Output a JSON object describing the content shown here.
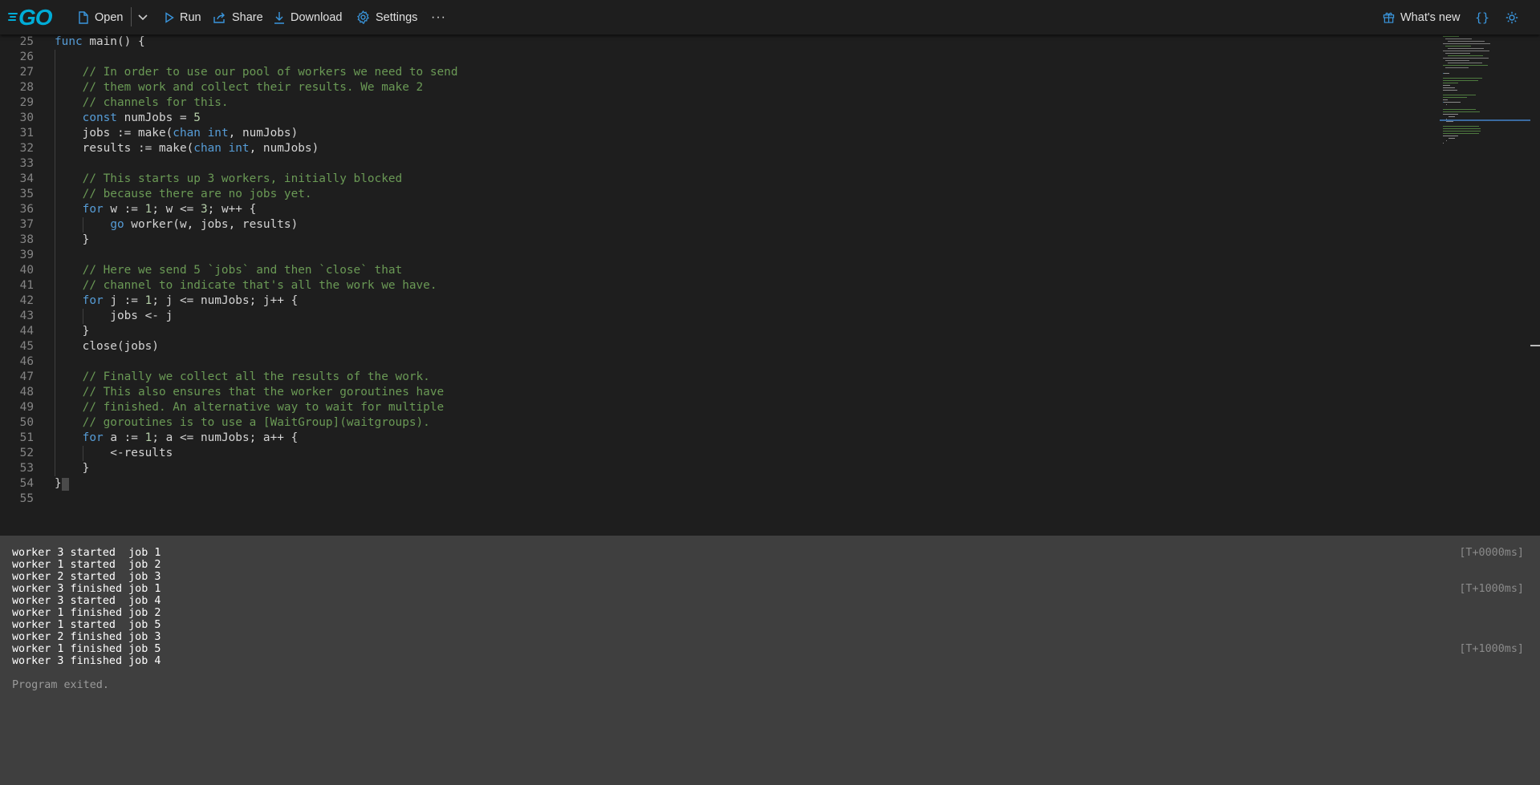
{
  "app": {
    "logo_text": "GO"
  },
  "toolbar": {
    "open_label": "Open",
    "run_label": "Run",
    "share_label": "Share",
    "download_label": "Download",
    "settings_label": "Settings",
    "more_label": "···",
    "whats_new_label": "What's new",
    "format_label": "{}"
  },
  "editor": {
    "lines": [
      {
        "n": "25",
        "tokens": [
          {
            "t": "k",
            "s": "func"
          },
          {
            "t": "p",
            "s": " main() {"
          }
        ]
      },
      {
        "n": "26",
        "tokens": []
      },
      {
        "n": "27",
        "tokens": [
          {
            "t": "p",
            "s": "    "
          },
          {
            "t": "c",
            "s": "// In order to use our pool of workers we need to send"
          }
        ]
      },
      {
        "n": "28",
        "tokens": [
          {
            "t": "p",
            "s": "    "
          },
          {
            "t": "c",
            "s": "// them work and collect their results. We make 2"
          }
        ]
      },
      {
        "n": "29",
        "tokens": [
          {
            "t": "p",
            "s": "    "
          },
          {
            "t": "c",
            "s": "// channels for this."
          }
        ]
      },
      {
        "n": "30",
        "tokens": [
          {
            "t": "p",
            "s": "    "
          },
          {
            "t": "k",
            "s": "const"
          },
          {
            "t": "p",
            "s": " numJobs = "
          },
          {
            "t": "n",
            "s": "5"
          }
        ]
      },
      {
        "n": "31",
        "tokens": [
          {
            "t": "p",
            "s": "    jobs := make("
          },
          {
            "t": "k",
            "s": "chan"
          },
          {
            "t": "p",
            "s": " "
          },
          {
            "t": "k",
            "s": "int"
          },
          {
            "t": "p",
            "s": ", numJobs)"
          }
        ]
      },
      {
        "n": "32",
        "tokens": [
          {
            "t": "p",
            "s": "    results := make("
          },
          {
            "t": "k",
            "s": "chan"
          },
          {
            "t": "p",
            "s": " "
          },
          {
            "t": "k",
            "s": "int"
          },
          {
            "t": "p",
            "s": ", numJobs)"
          }
        ]
      },
      {
        "n": "33",
        "tokens": []
      },
      {
        "n": "34",
        "tokens": [
          {
            "t": "p",
            "s": "    "
          },
          {
            "t": "c",
            "s": "// This starts up 3 workers, initially blocked"
          }
        ]
      },
      {
        "n": "35",
        "tokens": [
          {
            "t": "p",
            "s": "    "
          },
          {
            "t": "c",
            "s": "// because there are no jobs yet."
          }
        ]
      },
      {
        "n": "36",
        "tokens": [
          {
            "t": "p",
            "s": "    "
          },
          {
            "t": "k",
            "s": "for"
          },
          {
            "t": "p",
            "s": " w := "
          },
          {
            "t": "n",
            "s": "1"
          },
          {
            "t": "p",
            "s": "; w <= "
          },
          {
            "t": "n",
            "s": "3"
          },
          {
            "t": "p",
            "s": "; w++ {"
          }
        ]
      },
      {
        "n": "37",
        "tokens": [
          {
            "t": "p",
            "s": "        "
          },
          {
            "t": "k",
            "s": "go"
          },
          {
            "t": "p",
            "s": " worker(w, jobs, results)"
          }
        ]
      },
      {
        "n": "38",
        "tokens": [
          {
            "t": "p",
            "s": "    }"
          }
        ]
      },
      {
        "n": "39",
        "tokens": []
      },
      {
        "n": "40",
        "tokens": [
          {
            "t": "p",
            "s": "    "
          },
          {
            "t": "c",
            "s": "// Here we send 5 `jobs` and then `close` that"
          }
        ]
      },
      {
        "n": "41",
        "tokens": [
          {
            "t": "p",
            "s": "    "
          },
          {
            "t": "c",
            "s": "// channel to indicate that's all the work we have."
          }
        ]
      },
      {
        "n": "42",
        "tokens": [
          {
            "t": "p",
            "s": "    "
          },
          {
            "t": "k",
            "s": "for"
          },
          {
            "t": "p",
            "s": " j := "
          },
          {
            "t": "n",
            "s": "1"
          },
          {
            "t": "p",
            "s": "; j <= numJobs; j++ {"
          }
        ]
      },
      {
        "n": "43",
        "tokens": [
          {
            "t": "p",
            "s": "        jobs <- j"
          }
        ]
      },
      {
        "n": "44",
        "tokens": [
          {
            "t": "p",
            "s": "    }"
          }
        ]
      },
      {
        "n": "45",
        "tokens": [
          {
            "t": "p",
            "s": "    close(jobs)"
          }
        ]
      },
      {
        "n": "46",
        "tokens": []
      },
      {
        "n": "47",
        "tokens": [
          {
            "t": "p",
            "s": "    "
          },
          {
            "t": "c",
            "s": "// Finally we collect all the results of the work."
          }
        ]
      },
      {
        "n": "48",
        "tokens": [
          {
            "t": "p",
            "s": "    "
          },
          {
            "t": "c",
            "s": "// This also ensures that the worker goroutines have"
          }
        ]
      },
      {
        "n": "49",
        "tokens": [
          {
            "t": "p",
            "s": "    "
          },
          {
            "t": "c",
            "s": "// finished. An alternative way to wait for multiple"
          }
        ]
      },
      {
        "n": "50",
        "tokens": [
          {
            "t": "p",
            "s": "    "
          },
          {
            "t": "c",
            "s": "// goroutines is to use a [WaitGroup](waitgroups)."
          }
        ]
      },
      {
        "n": "51",
        "tokens": [
          {
            "t": "p",
            "s": "    "
          },
          {
            "t": "k",
            "s": "for"
          },
          {
            "t": "p",
            "s": " a := "
          },
          {
            "t": "n",
            "s": "1"
          },
          {
            "t": "p",
            "s": "; a <= numJobs; a++ {"
          }
        ]
      },
      {
        "n": "52",
        "tokens": [
          {
            "t": "p",
            "s": "        <-results"
          }
        ]
      },
      {
        "n": "53",
        "tokens": [
          {
            "t": "p",
            "s": "    }"
          }
        ]
      },
      {
        "n": "54",
        "tokens": [
          {
            "t": "p",
            "s": "}"
          }
        ]
      },
      {
        "n": "55",
        "tokens": []
      }
    ]
  },
  "output": {
    "lines": [
      "worker 3 started  job 1",
      "worker 1 started  job 2",
      "worker 2 started  job 3",
      "worker 3 finished job 1",
      "worker 3 started  job 4",
      "worker 1 finished job 2",
      "worker 1 started  job 5",
      "worker 2 finished job 3",
      "worker 1 finished job 5",
      "worker 3 finished job 4"
    ],
    "timestamps": [
      {
        "line": 0,
        "text": "[T+0000ms]"
      },
      {
        "line": 3,
        "text": "[T+1000ms]"
      },
      {
        "line": 8,
        "text": "[T+1000ms]"
      }
    ],
    "exit_message": "Program exited."
  },
  "colors": {
    "keyword": "#569cd6",
    "comment": "#6a9955",
    "number": "#b5cea8",
    "accent": "#00acd7",
    "icon_blue": "#3a96dd"
  }
}
